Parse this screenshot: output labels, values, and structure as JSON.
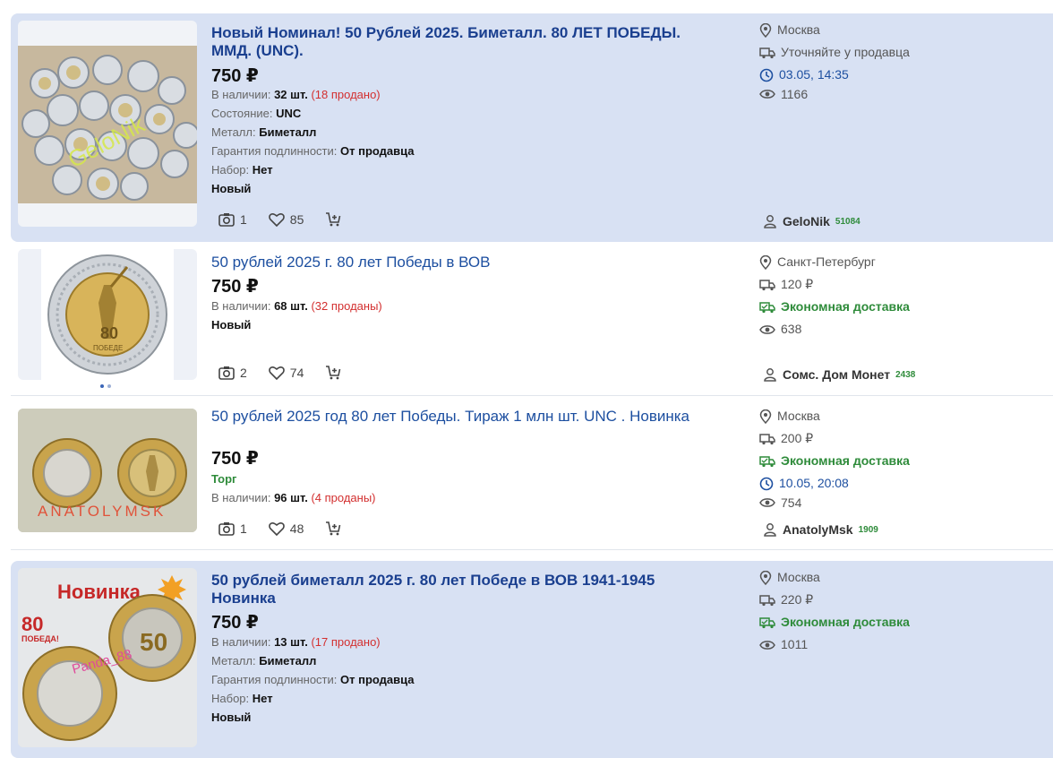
{
  "listings": [
    {
      "title": "Новый Номинал! 50 Рублей 2025. Биметалл. 80 ЛЕТ ПОБЕДЫ. ММД. (UNC).",
      "price": "750 ₽",
      "stock_label": "В наличии:",
      "stock_value": "32 шт.",
      "stock_sold": "(18 продано)",
      "condition_label": "Состояние:",
      "condition_value": "UNC",
      "metal_label": "Металл:",
      "metal_value": "Биметалл",
      "guarantee_label": "Гарантия подлинности:",
      "guarantee_value": "От продавца",
      "set_label": "Набор:",
      "set_value": "Нет",
      "new_tag": "Новый",
      "photos": "1",
      "likes": "85",
      "location": "Москва",
      "delivery": "Уточняйте у продавца",
      "time": "03.05, 14:35",
      "views": "1166",
      "seller": "GeloNik",
      "seller_rating": "51084",
      "watermark": "GeloNik"
    },
    {
      "title": "50 рублей 2025 г. 80 лет Победы в ВОВ",
      "price": "750 ₽",
      "stock_label": "В наличии:",
      "stock_value": "68 шт.",
      "stock_sold": "(32 проданы)",
      "new_tag": "Новый",
      "photos": "2",
      "likes": "74",
      "location": "Санкт-Петербург",
      "delivery": "120 ₽",
      "delivery_eco": "Экономная доставка",
      "views": "638",
      "seller": "Сомс. Дом Монет",
      "seller_rating": "2438"
    },
    {
      "title": "50 рублей 2025 год 80 лет Победы. Тираж 1 млн шт. UNC . Новинка",
      "price": "750 ₽",
      "torg": "Торг",
      "stock_label": "В наличии:",
      "stock_value": "96 шт.",
      "stock_sold": "(4 проданы)",
      "photos": "1",
      "likes": "48",
      "location": "Москва",
      "delivery": "200 ₽",
      "delivery_eco": "Экономная доставка",
      "time": "10.05, 20:08",
      "views": "754",
      "seller": "AnatolyMsk",
      "seller_rating": "1909",
      "watermark": "ANATOLYMSK"
    },
    {
      "title": "50 рублей биметалл 2025 г. 80 лет Победе в ВОВ 1941-1945 Новинка",
      "price": "750 ₽",
      "stock_label": "В наличии:",
      "stock_value": "13 шт.",
      "stock_sold": "(17 продано)",
      "metal_label": "Металл:",
      "metal_value": "Биметалл",
      "guarantee_label": "Гарантия подлинности:",
      "guarantee_value": "От продавца",
      "set_label": "Набор:",
      "set_value": "Нет",
      "new_tag": "Новый",
      "location": "Москва",
      "delivery": "220 ₽",
      "delivery_eco": "Экономная доставка",
      "views": "1011",
      "photo_caption": "Новинка",
      "photo_badge_number": "80",
      "photo_badge_text": "ПОБЕДА!",
      "watermark": "Panda_88"
    }
  ],
  "coin_mark": "80",
  "coin_sub": "ПОБЕДЕ",
  "colors": {
    "highlight": "#d8e1f3",
    "link": "#1d4fa0",
    "green": "#2e8b3a",
    "sold": "#d32f2f"
  }
}
